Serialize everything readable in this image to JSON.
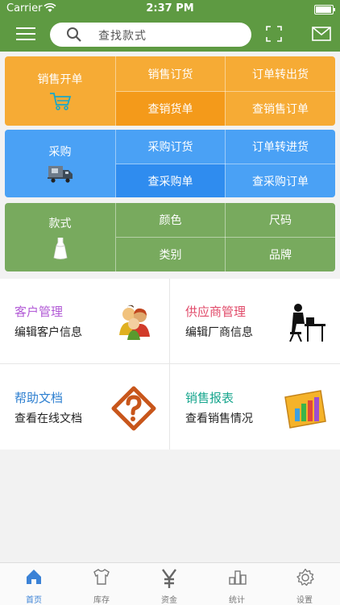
{
  "status_bar": {
    "carrier": "Carrier",
    "time": "2:37 PM"
  },
  "nav": {
    "search_placeholder": "查找款式"
  },
  "sales": {
    "main": "销售开单",
    "order": "销售订货",
    "transfer": "订单转出货",
    "check_goods": "查销货单",
    "check_orders": "查销售订单"
  },
  "purchase": {
    "main": "采购",
    "order": "采购订货",
    "transfer": "订单转进货",
    "check_goods": "查采购单",
    "check_orders": "查采购订单"
  },
  "style": {
    "main": "款式",
    "color": "颜色",
    "size": "尺码",
    "category": "类别",
    "brand": "品牌"
  },
  "cards": [
    {
      "title": "客户管理",
      "sub": "编辑客户信息",
      "icon": "customers-icon"
    },
    {
      "title": "供应商管理",
      "sub": "编辑厂商信息",
      "icon": "supplier-icon"
    },
    {
      "title": "帮助文档",
      "sub": "查看在线文档",
      "icon": "help-icon"
    },
    {
      "title": "销售报表",
      "sub": "查看销售情况",
      "icon": "report-icon"
    }
  ],
  "tabs": [
    {
      "label": "首页",
      "icon": "home-icon"
    },
    {
      "label": "库存",
      "icon": "shirt-icon"
    },
    {
      "label": "资金",
      "icon": "yen-icon"
    },
    {
      "label": "统计",
      "icon": "stats-icon"
    },
    {
      "label": "设置",
      "icon": "gear-icon"
    }
  ],
  "colors": {
    "nav_green": "#5e9a42",
    "sales_orange": "#f6ab35",
    "purchase_blue": "#4aa1f5",
    "style_green": "#78aa5e",
    "tab_active": "#3b82d6"
  }
}
